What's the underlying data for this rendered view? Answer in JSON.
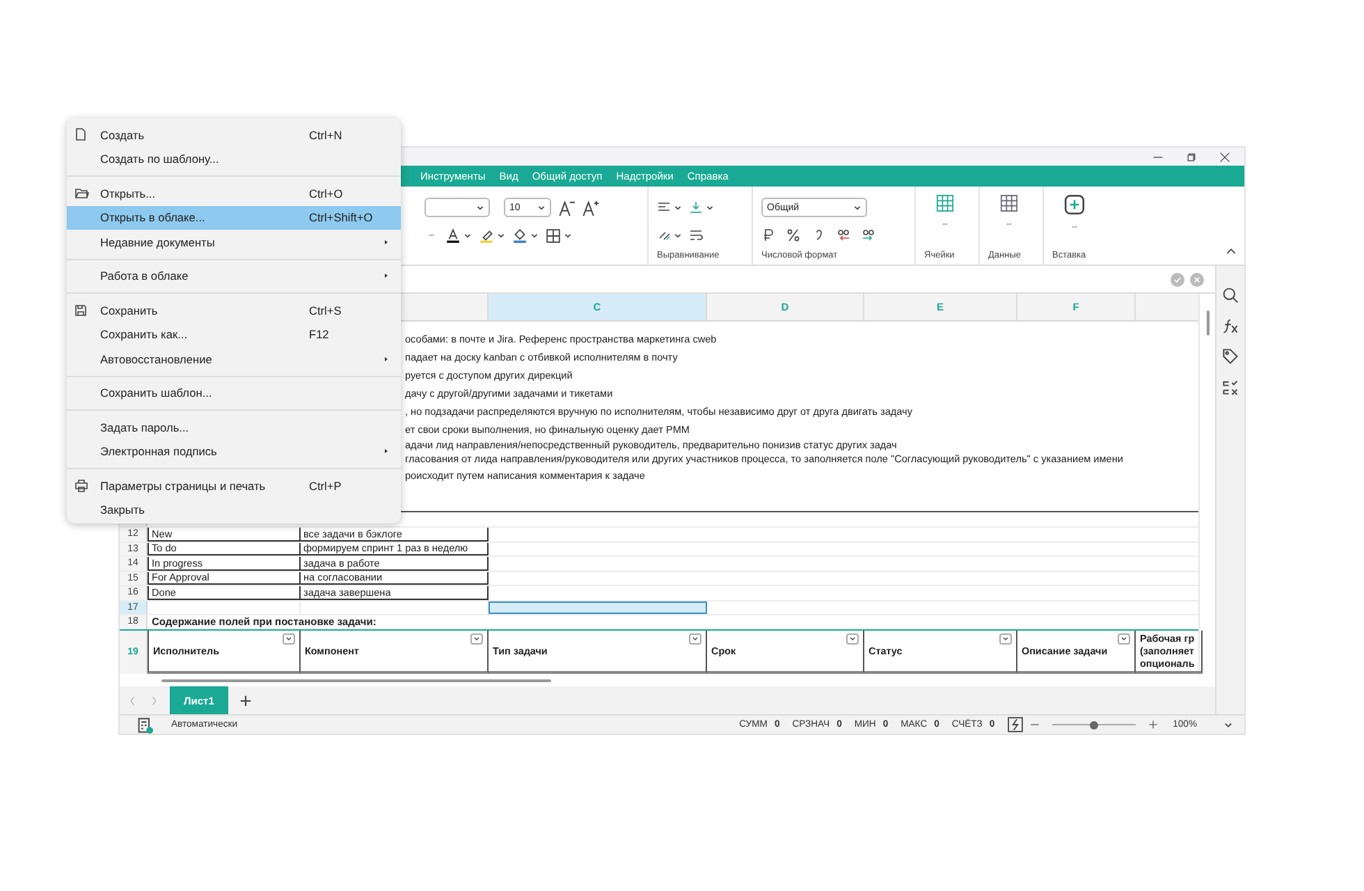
{
  "menu_tabs": [
    "Инструменты",
    "Вид",
    "Общий доступ",
    "Надстройки",
    "Справка"
  ],
  "ribbon": {
    "font_size": "10",
    "number_format": "Общий",
    "groups": [
      "Выравнивание",
      "Числовой формат",
      "Ячейки",
      "Данные",
      "Вставка"
    ]
  },
  "file_menu": {
    "groups": [
      [
        {
          "label": "Создать",
          "shortcut": "Ctrl+N",
          "submenu": false,
          "selected": false
        },
        {
          "label": "Создать по шаблону...",
          "submenu": false,
          "selected": false
        }
      ],
      [
        {
          "label": "Открыть...",
          "shortcut": "Ctrl+O",
          "submenu": false,
          "selected": false
        },
        {
          "label": "Открыть в облаке...",
          "shortcut": "Ctrl+Shift+O",
          "submenu": false,
          "selected": true
        },
        {
          "label": "Недавние документы",
          "submenu": true,
          "selected": false
        }
      ],
      [
        {
          "label": "Работа в облаке",
          "submenu": true,
          "selected": false
        }
      ],
      [
        {
          "label": "Сохранить",
          "shortcut": "Ctrl+S",
          "submenu": false,
          "selected": false
        },
        {
          "label": "Сохранить как...",
          "shortcut": "F12",
          "submenu": false,
          "selected": false
        },
        {
          "label": "Автовосстановление",
          "submenu": true,
          "selected": false
        }
      ],
      [
        {
          "label": "Сохранить шаблон...",
          "submenu": false,
          "selected": false
        }
      ],
      [
        {
          "label": "Задать пароль...",
          "submenu": false,
          "selected": false
        },
        {
          "label": "Электронная подпись",
          "submenu": true,
          "selected": false
        }
      ],
      [
        {
          "label": "Параметры страницы и печать",
          "shortcut": "Ctrl+P",
          "submenu": false,
          "selected": false
        },
        {
          "label": "Закрыть",
          "submenu": false,
          "selected": false
        }
      ]
    ]
  },
  "columns": [
    {
      "label": "C",
      "selected": true
    },
    {
      "label": "D",
      "selected": false
    },
    {
      "label": "E",
      "selected": false
    },
    {
      "label": "F",
      "selected": false
    }
  ],
  "notes": [
    {
      "lines": [
        "особами: в почте и Jira. Референс пространства маркетинга cweb"
      ]
    },
    {
      "lines": [
        "падает на доску kanban с отбивкой исполнителям в почту"
      ]
    },
    {
      "lines": [
        "руется с доступом других дирекций"
      ]
    },
    {
      "lines": [
        "дачу с другой/другими задачами и тикетами"
      ]
    },
    {
      "lines": [
        ", но подзадачи распределяются вручную по исполнителям, чтобы независимо друг от друга двигать задачу"
      ]
    },
    {
      "lines": [
        "ет свои сроки выполнения, но финальную оценку дает PMM"
      ]
    },
    {
      "lines": [
        "адачи лид направления/непосредственный руководитель, предварительно понизив статус других задач",
        "гласования от лида направления/руководителя или других участников процесса, то заполняется поле \"Согласующий руководитель\" с указанием имени"
      ]
    },
    {
      "lines": [
        "роисходит путем написания комментария к задаче"
      ]
    }
  ],
  "status_rows": [
    {
      "num": "12",
      "a": "New",
      "b": "все задачи в бэклоге"
    },
    {
      "num": "13",
      "a": "To do",
      "b": "формируем спринт 1 раз в неделю"
    },
    {
      "num": "14",
      "a": "In progress",
      "b": "задача в работе"
    },
    {
      "num": "15",
      "a": "For Approval",
      "b": "на согласовании"
    },
    {
      "num": "16",
      "a": "Done",
      "b": "задача завершена"
    }
  ],
  "empty_row": {
    "num": "17",
    "selected": true
  },
  "section_row": {
    "num": "18",
    "title": "Содержание полей при постановке задачи:"
  },
  "header_row": {
    "num": "19",
    "cells": [
      {
        "lines": [
          "Исполнитель"
        ],
        "filter": true
      },
      {
        "lines": [
          "Компонент"
        ],
        "filter": true
      },
      {
        "lines": [
          "Тип задачи"
        ],
        "filter": true
      },
      {
        "lines": [
          "Срок"
        ],
        "filter": true
      },
      {
        "lines": [
          "Статус"
        ],
        "filter": true
      },
      {
        "lines": [
          "Описание задачи"
        ],
        "filter": true
      },
      {
        "lines": [
          "Рабочая гр",
          "(заполняет",
          "опциональ"
        ],
        "filter": false
      }
    ]
  },
  "sheet_tabs": [
    {
      "label": "Лист1",
      "selected": true
    }
  ],
  "status_bar": {
    "mode": "Автоматически",
    "stats": [
      {
        "label": "СУММ",
        "value": "0"
      },
      {
        "label": "СРЗНАЧ",
        "value": "0"
      },
      {
        "label": "МИН",
        "value": "0"
      },
      {
        "label": "МАКС",
        "value": "0"
      },
      {
        "label": "СЧЁТЗ",
        "value": "0"
      }
    ],
    "zoom_slider": {
      "level": 0.5
    },
    "zoom": "100%"
  }
}
